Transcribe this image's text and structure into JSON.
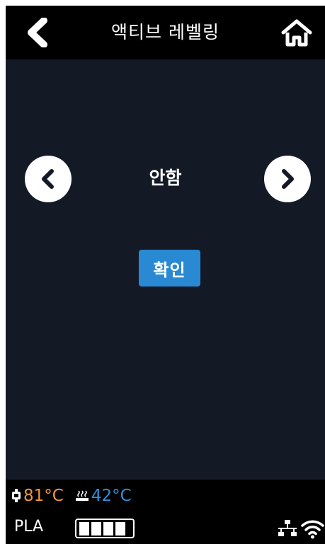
{
  "header": {
    "title": "액티브 레벨링"
  },
  "selector": {
    "value": "안함"
  },
  "confirm": {
    "label": "확인"
  },
  "status": {
    "nozzle_temp": "81°C",
    "bed_temp": "42°C",
    "material": "PLA",
    "filament_level": 1.0
  },
  "colors": {
    "accent": "#2a89d3",
    "nozzle_temp": "#f0973a",
    "bed_temp": "#2f8fd8",
    "background": "#131a26",
    "bar": "#000000"
  },
  "icons": {
    "back": "chevron-left-icon",
    "home": "home-icon",
    "prev": "chevron-left-circle-icon",
    "next": "chevron-right-circle-icon",
    "nozzle": "nozzle-icon",
    "bed": "heated-bed-icon",
    "network": "network-icon",
    "wifi": "wifi-icon"
  }
}
